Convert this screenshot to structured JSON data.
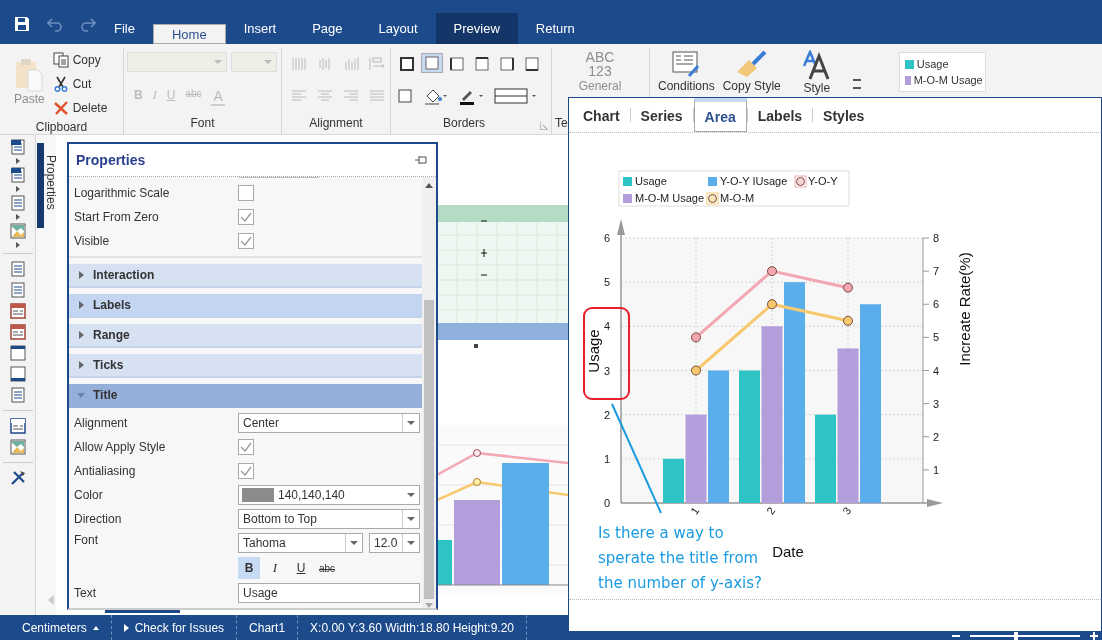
{
  "menu_bar": {
    "tabs": [
      {
        "label": "File",
        "selected": false,
        "highlighted": false
      },
      {
        "label": "Home",
        "selected": true,
        "highlighted": false
      },
      {
        "label": "Insert",
        "selected": false,
        "highlighted": false
      },
      {
        "label": "Page",
        "selected": false,
        "highlighted": false
      },
      {
        "label": "Layout",
        "selected": false,
        "highlighted": false
      },
      {
        "label": "Preview",
        "selected": false,
        "highlighted": true
      },
      {
        "label": "Return",
        "selected": false,
        "highlighted": false
      }
    ]
  },
  "ribbon": {
    "clipboard": {
      "title": "Clipboard",
      "paste": {
        "label": "Paste",
        "disabled": true
      },
      "actions": [
        {
          "label": "Copy",
          "kind": "copy"
        },
        {
          "label": "Cut",
          "kind": "cut"
        },
        {
          "label": "Delete",
          "kind": "delete"
        }
      ]
    },
    "font": {
      "title": "Font",
      "buttons": [
        {
          "label": "B",
          "kind": "bold"
        },
        {
          "label": "I",
          "kind": "italic"
        },
        {
          "label": "U",
          "kind": "underline"
        },
        {
          "label": "abc",
          "kind": "strike"
        },
        {
          "label": "A",
          "kind": "color"
        }
      ]
    },
    "alignment": {
      "title": "Alignment"
    },
    "borders": {
      "title": "Borders",
      "presets": [
        {
          "kind": "all",
          "selected": false
        },
        {
          "kind": "outside",
          "selected": true
        },
        {
          "kind": "left",
          "selected": false
        },
        {
          "kind": "top",
          "selected": false
        },
        {
          "kind": "right",
          "selected": false
        },
        {
          "kind": "bottom",
          "selected": false
        }
      ]
    },
    "text_group": {
      "title": "Te",
      "format_lines": [
        "ABC",
        "123"
      ],
      "format_label": "General"
    },
    "style_group": {
      "buttons": [
        {
          "label": "Conditions",
          "kind": "conditions"
        },
        {
          "label": "Copy Style",
          "kind": "copy_style"
        },
        {
          "label": "Style",
          "kind": "style"
        }
      ],
      "preview": [
        {
          "label": "Usage",
          "color": "#2ec4c6"
        },
        {
          "label": "M-O-M Usage",
          "color": "#b39ddb"
        }
      ]
    }
  },
  "side_tab": {
    "label": "Properties"
  },
  "properties": {
    "title": "Properties",
    "rows": [
      {
        "kind": "checkbox",
        "label": "Logarithmic Scale",
        "checked": false
      },
      {
        "kind": "checkbox",
        "label": "Start From Zero",
        "checked": true
      },
      {
        "kind": "checkbox",
        "label": "Visible",
        "checked": true
      },
      {
        "kind": "section",
        "label": "Interaction",
        "expanded": false,
        "highlighted": false
      },
      {
        "kind": "section",
        "label": "Labels",
        "expanded": false,
        "highlighted": true
      },
      {
        "kind": "section",
        "label": "Range",
        "expanded": false,
        "highlighted": false
      },
      {
        "kind": "section",
        "label": "Ticks",
        "expanded": false,
        "highlighted": false
      },
      {
        "kind": "section",
        "label": "Title",
        "expanded": true,
        "highlighted": false
      },
      {
        "kind": "select",
        "label": "Alignment",
        "value": "Center"
      },
      {
        "kind": "checkbox",
        "label": "Allow Apply Style",
        "checked": true
      },
      {
        "kind": "checkbox",
        "label": "Antialiasing",
        "checked": true
      },
      {
        "kind": "color",
        "label": "Color",
        "value": "140,140,140",
        "color": "#8c8c8c"
      },
      {
        "kind": "select",
        "label": "Direction",
        "value": "Bottom to Top"
      },
      {
        "kind": "font",
        "label": "Font",
        "family": "Tahoma",
        "size": "12.0",
        "styles": [
          {
            "label": "B",
            "kind": "bold",
            "selected": true
          },
          {
            "label": "I",
            "kind": "italic",
            "selected": false
          },
          {
            "label": "U",
            "kind": "underline",
            "selected": false
          },
          {
            "label": "abc",
            "kind": "strike",
            "selected": false
          }
        ]
      },
      {
        "kind": "text",
        "label": "Text",
        "value": "Usage"
      }
    ]
  },
  "chart_editor": {
    "tabs": [
      {
        "label": "Chart",
        "selected": false
      },
      {
        "label": "Series",
        "selected": false
      },
      {
        "label": "Area",
        "selected": true
      },
      {
        "label": "Labels",
        "selected": false
      },
      {
        "label": "Styles",
        "selected": false
      }
    ],
    "chart_data": {
      "type": "bar",
      "xlabel": "Date",
      "ylabel": "Usage",
      "categories": [
        "1",
        "2",
        "3"
      ],
      "series": [
        {
          "name": "Usage",
          "color": "#2ec4c6",
          "values": [
            1,
            3,
            2
          ]
        },
        {
          "name": "M-O-M Usage",
          "color": "#b39ddb",
          "values": [
            2,
            4,
            3.5
          ]
        },
        {
          "name": "Y-O-Y IUsage",
          "color": "#5aaeec",
          "values": [
            3,
            5,
            4.5
          ]
        }
      ],
      "ylim": [
        0,
        6
      ],
      "yticks": [
        0,
        1,
        2,
        3,
        4,
        5,
        6
      ],
      "grid": true,
      "legend": true
    },
    "rate_chart": {
      "chart_data": {
        "type": "line",
        "ylabel": "Increate Rate(%)",
        "series": [
          {
            "name": "M-O-M",
            "color": "#f7c96e",
            "values": [
              4,
              6,
              5.5
            ],
            "marker": true
          },
          {
            "name": "Y-O-Y",
            "color": "#f2a7b2",
            "values": [
              5,
              7,
              6.5
            ],
            "marker": true
          }
        ],
        "ylim": [
          0,
          8
        ],
        "yticks": [
          1,
          2,
          3,
          4,
          5,
          6,
          7,
          8
        ]
      }
    },
    "annotation": {
      "lines": [
        "Is there a way to",
        "sperate the title from",
        "the number of y-axis?"
      ]
    }
  },
  "status_bar": {
    "items": [
      {
        "label": "Centimeters",
        "kind": "unit"
      },
      {
        "label": "Check for Issues",
        "kind": "check"
      },
      {
        "label": "Chart1",
        "kind": "plain"
      },
      {
        "label": "X:0.00 Y:3.60 Width:18.80 Height:9.20",
        "kind": "plain"
      }
    ],
    "zoom": {
      "level": 0.4
    }
  }
}
